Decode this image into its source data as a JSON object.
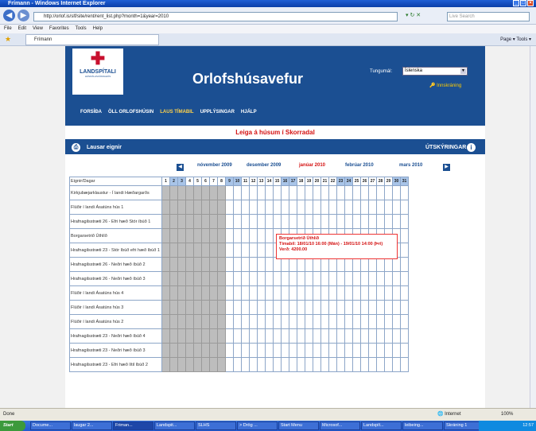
{
  "window": {
    "title": "Frímann - Windows Internet Explorer",
    "url": "http://orlof.is/slf/site/rent/rent_list.php?month=1&year=2010",
    "search_placeholder": "Live Search"
  },
  "menu": [
    "File",
    "Edit",
    "View",
    "Favorites",
    "Tools",
    "Help"
  ],
  "tab": {
    "title": "Frímann"
  },
  "tabtools": "Page ▾  Tools ▾",
  "site": {
    "logo_name": "LANDSPÍTALI",
    "logo_sub": "HÁSKÓLASJÚKRAHÚS",
    "title": "Orlofshúsavefur",
    "lang_label": "Tungumál:",
    "lang_value": "Íslenska",
    "login": "Innskráning",
    "nav": [
      "FORSÍÐA",
      "ÖLL ORLOFSHÚSIN",
      "LAUS TÍMABIL",
      "UPPLÝSINGAR",
      "HJÁLP"
    ],
    "subtitle": "Leiga á húsum í Skorradal",
    "lausar": "Lausar eignir",
    "skyringar": "ÚTSKÝRINGAR"
  },
  "calendar": {
    "months": [
      "nóvember 2009",
      "desember 2009",
      "janúar 2010",
      "febrúar 2010",
      "mars 2010"
    ],
    "current_month": "janúar 2010",
    "header": "Eignir/Dagar",
    "weekend_days": [
      2,
      3,
      9,
      10,
      16,
      17,
      23,
      24,
      30,
      31
    ],
    "past_days": 8,
    "properties": [
      "Kirkjubæjarklaustur - Í landi Hæðargarðs",
      "Flúðir í landi Ásatúns hús 1",
      "Hrafnagilsstræti 26 - Efri hæð Stór íbúð 1",
      "Borgarsetrið Úthlíð",
      "Hrafnagilsstræti 23 - Stór íbúð efri hæð íbúð 1",
      "Hrafnagilsstræti 26 - Neðri hæð íbúð 2",
      "Hrafnagilsstræti 26 - Neðri hæð íbúð 3",
      "Flúðir í landi Ásatúns hús 4",
      "Flúðir í landi Ásatúns hús 3",
      "Flúðir í landi Ásatúns hús 2",
      "Hrafnagilsstræti 23 - Neðri hæð íbúð 4",
      "Hrafnagilsstræti 23 - Neðri hæð íbúð 3",
      "Hrafnagilsstræti 23 - Efri hæð lítil íbúð 2"
    ]
  },
  "tooltip": {
    "name": "Borgarsetrið Úthlíð",
    "period": "Tímabil: 18/01/10 16:00 (Mán) - 19/01/10 14:00 (Þri)",
    "price": "Verð: 4200.00"
  },
  "status": {
    "text": "Done",
    "zone": "Internet",
    "zoom": "100%"
  },
  "taskbar": {
    "start": "Start",
    "tasks": [
      "Docume...",
      "laugar 2...",
      "Friman...",
      "Landspit...",
      "SLHS",
      "> Drög ...",
      "Start Menu",
      "Microsof...",
      "Landspít...",
      "leibeing...",
      "Skráning 1"
    ],
    "clock": "12:57"
  }
}
